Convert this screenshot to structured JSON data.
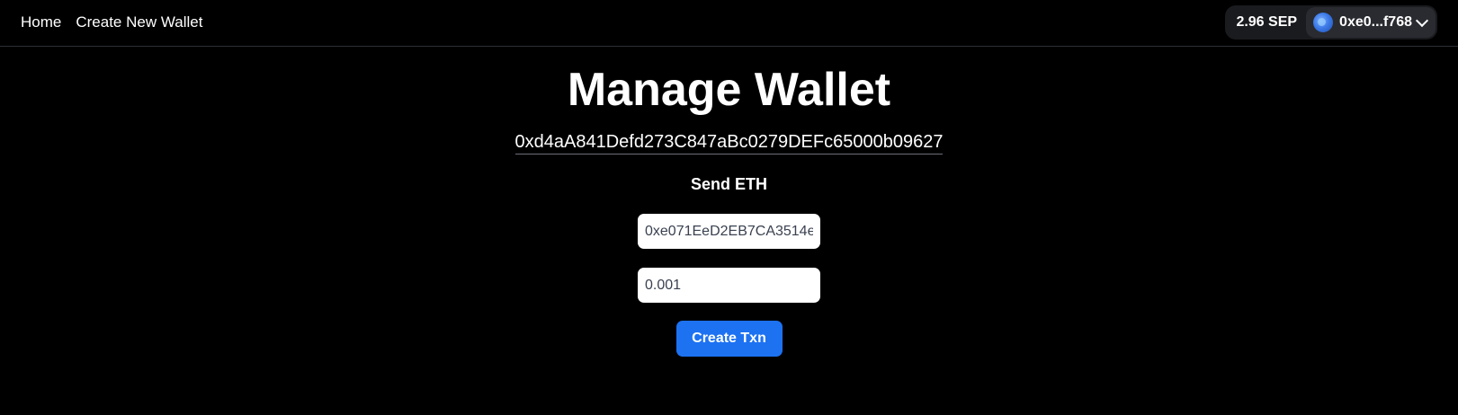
{
  "nav": {
    "links": [
      {
        "label": "Home"
      },
      {
        "label": "Create New Wallet"
      }
    ]
  },
  "account": {
    "balance": "2.96 SEP",
    "short_address": "0xe0...f768",
    "avatar_icon": "globe-icon",
    "dropdown_icon": "chevron-down-icon"
  },
  "main": {
    "title": "Manage Wallet",
    "wallet_address": "0xd4aA841Defd273C847aBc0279DEFc65000b09627",
    "send_heading": "Send ETH",
    "to_address_value": "0xe071EeD2EB7CA3514e",
    "amount_value": "0.001",
    "create_button_label": "Create Txn"
  },
  "colors": {
    "background": "#000000",
    "primary_button": "#1d72f2",
    "account_pill": "#1a1b1f",
    "address_button": "#2a2b30"
  }
}
